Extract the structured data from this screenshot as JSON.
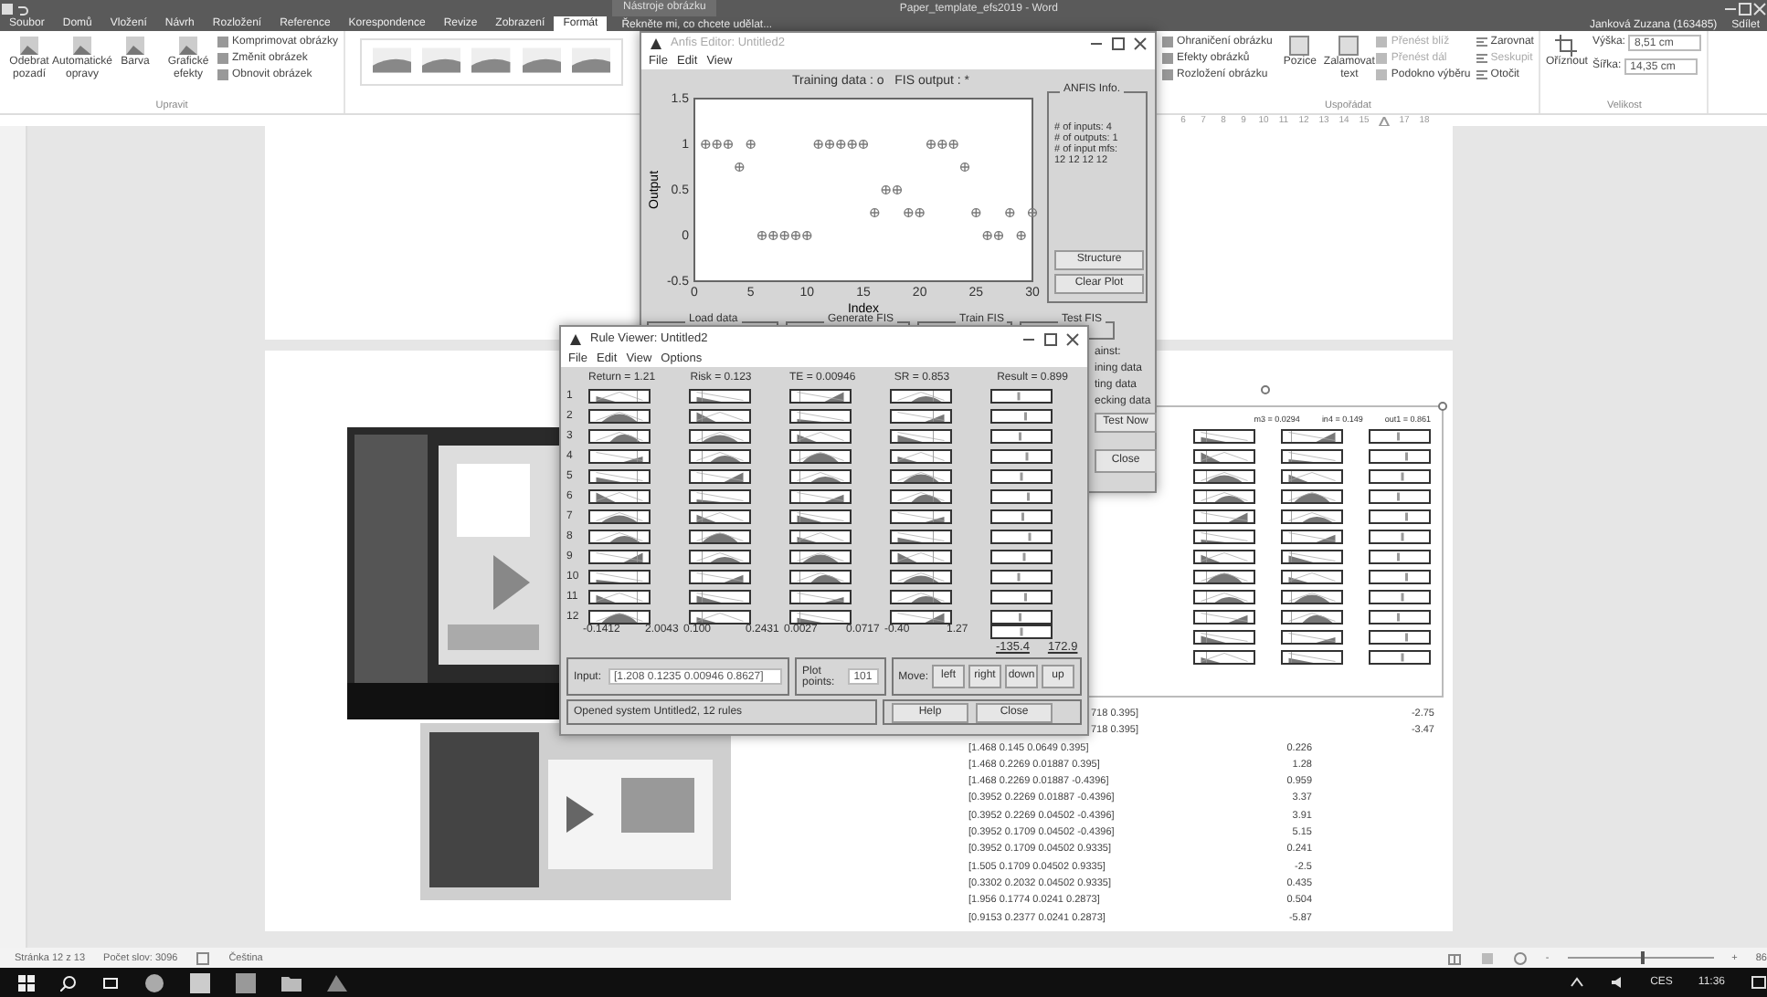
{
  "word": {
    "title_bar": {
      "context": "Nástroje obrázku",
      "title": "Paper_template_efs2019 - Word"
    },
    "tabs": [
      {
        "label": "Soubor",
        "selected": false
      },
      {
        "label": "Domů",
        "selected": false
      },
      {
        "label": "Vložení",
        "selected": false
      },
      {
        "label": "Návrh",
        "selected": false
      },
      {
        "label": "Rozložení",
        "selected": false
      },
      {
        "label": "Reference",
        "selected": false
      },
      {
        "label": "Korespondence",
        "selected": false
      },
      {
        "label": "Revize",
        "selected": false
      },
      {
        "label": "Zobrazení",
        "selected": false
      },
      {
        "label": "Formát",
        "selected": true
      }
    ],
    "tell_me": "Řekněte mi, co chcete udělat...",
    "user": "Janková Zuzana (163485)",
    "share": "Sdílet",
    "ribbon_left": {
      "big_buttons": [
        "Odebrat pozadí",
        "Automatické opravy",
        "Barva",
        "Grafické efekty"
      ],
      "small_buttons": [
        "Komprimovat obrázky",
        "Změnit obrázek",
        "Obnovit obrázek"
      ],
      "group": "Upravit"
    },
    "ribbon_right": {
      "style_buttons": [
        "Ohraničení obrázku",
        "Efekty obrázků",
        "Rozložení obrázku"
      ],
      "arrange_big": [
        "Pozice",
        "Zalamovat text"
      ],
      "arrange_small": [
        "Přenést blíž",
        "Přenést dál",
        "Podokno výběru"
      ],
      "align": [
        "Zarovnat",
        "Seskupit",
        "Otočit"
      ],
      "arrange_group": "Uspořádat",
      "crop": "Oříznout",
      "height_label": "Výška:",
      "height": "8,51 cm",
      "width_label": "Šířka:",
      "width": "14,35 cm",
      "size_group": "Velikost"
    },
    "ruler": [
      {
        "kind": "number",
        "text": "6"
      },
      {
        "kind": "number",
        "text": "7"
      },
      {
        "kind": "number",
        "text": "8"
      },
      {
        "kind": "number",
        "text": "9"
      },
      {
        "kind": "number",
        "text": "10"
      },
      {
        "kind": "number",
        "text": "11"
      },
      {
        "kind": "number",
        "text": "12"
      },
      {
        "kind": "number",
        "text": "13"
      },
      {
        "kind": "number",
        "text": "14"
      },
      {
        "kind": "number",
        "text": "15"
      },
      {
        "kind": "marker"
      },
      {
        "kind": "number",
        "text": "17"
      },
      {
        "kind": "number",
        "text": "18"
      }
    ],
    "figure_labels": [
      "m3 = 0.0294",
      "in4 = 0.149",
      "out1 = 0.861"
    ],
    "results": [
      {
        "kind": "covered",
        "vector": "718 0.395]",
        "value": "-2.75"
      },
      {
        "kind": "covered",
        "vector": "718 0.395]",
        "value": "-3.47"
      },
      {
        "kind": "full",
        "vector": "[1.468 0.145 0.0649 0.395]",
        "value": "0.226"
      },
      {
        "kind": "full",
        "vector": "[1.468 0.2269 0.01887 0.395]",
        "value": "1.28"
      },
      {
        "kind": "full",
        "vector": "[1.468 0.2269 0.01887 -0.4396]",
        "value": "0.959"
      },
      {
        "kind": "full",
        "vector": "[0.3952 0.2269 0.01887 -0.4396]",
        "value": "3.37"
      },
      {
        "kind": "full",
        "vector": "[0.3952 0.2269 0.04502 -0.4396]",
        "value": "3.91"
      },
      {
        "kind": "full",
        "vector": "[0.3952 0.1709 0.04502 -0.4396]",
        "value": "5.15"
      },
      {
        "kind": "full",
        "vector": "[0.3952 0.1709 0.04502 0.9335]",
        "value": "0.241"
      },
      {
        "kind": "full",
        "vector": "[1.505 0.1709 0.04502 0.9335]",
        "value": "-2.5"
      },
      {
        "kind": "full",
        "vector": "[0.3302 0.2032 0.04502 0.9335]",
        "value": "0.435"
      },
      {
        "kind": "full",
        "vector": "[1.956 0.1774 0.0241 0.2873]",
        "value": "0.504"
      },
      {
        "kind": "full",
        "vector": "[0.9153 0.2377 0.0241 0.2873]",
        "value": "-5.87"
      }
    ],
    "status_bar": {
      "page": "Stránka 12 z 13",
      "words": "Počet slov: 3096",
      "language": "Čeština",
      "zoom_out": "-",
      "zoom_in": "+",
      "zoom": {
        "level": 0.5
      },
      "zoom_value": "86"
    }
  },
  "anfis": {
    "title": "Anfis Editor: Untitled2",
    "menu": [
      "File",
      "Edit",
      "View"
    ],
    "chart_data": {
      "type": "scatter",
      "title": "Training data : o   FIS output : *",
      "xlabel": "Index",
      "ylabel": "Output",
      "x": [
        1,
        2,
        3,
        4,
        5,
        6,
        7,
        8,
        9,
        10,
        11,
        12,
        13,
        14,
        15,
        16,
        17,
        18,
        19,
        20,
        21,
        22,
        23,
        24,
        25,
        26,
        27,
        28,
        29,
        30
      ],
      "series": [
        {
          "color": "#7a7a7a",
          "values": [
            1,
            1,
            1,
            0.75,
            1,
            0,
            0,
            0,
            0,
            0,
            1,
            1,
            1,
            1,
            1,
            0.25,
            0.5,
            0.5,
            0.25,
            0.25,
            1,
            1,
            1,
            0.75,
            0.25,
            0,
            0,
            0.25,
            0,
            0.25
          ]
        }
      ],
      "xlim": [
        0,
        30
      ],
      "ylim": [
        -0.5,
        1.5
      ],
      "xticks": [
        0,
        5,
        10,
        15,
        20,
        25,
        30
      ],
      "yticks": [
        -0.5,
        0,
        0.5,
        1,
        1.5
      ]
    },
    "info": {
      "title": "ANFIS Info.",
      "lines": [
        "# of inputs: 4",
        "# of outputs: 1",
        "# of input mfs:",
        "12 12 12 12"
      ],
      "buttons": [
        "Structure",
        "Clear Plot"
      ]
    },
    "panels": [
      "Load data",
      "Generate FIS",
      "Train FIS",
      "Test FIS"
    ],
    "test_lines": [
      "ainst:",
      "ining data",
      "ting data",
      "ecking data"
    ],
    "test_button": "Test Now",
    "close": "Close"
  },
  "rule_viewer": {
    "title": "Rule Viewer: Untitled2",
    "menu": [
      "File",
      "Edit",
      "View",
      "Options"
    ],
    "columns": [
      {
        "header": "Return = 1.21",
        "min": "-0.1412",
        "max": "2.0043"
      },
      {
        "header": "Risk = 0.123",
        "min": "0.100",
        "max": "0.2431"
      },
      {
        "header": "TE = 0.00946",
        "min": "0.0027",
        "max": "0.0717"
      },
      {
        "header": "SR = 0.853",
        "min": "-0.40",
        "max": "1.27"
      }
    ],
    "result": {
      "header": "Result = 0.899",
      "min": "-135.4",
      "max": "172.9"
    },
    "rules": [
      "1",
      "2",
      "3",
      "4",
      "5",
      "6",
      "7",
      "8",
      "9",
      "10",
      "11",
      "12"
    ],
    "input_label": "Input:",
    "input": "[1.208 0.1235 0.00946 0.8627]",
    "points_label": "Plot points:",
    "points": "101",
    "move_label": "Move:",
    "move_buttons": [
      "left",
      "right",
      "down",
      "up"
    ],
    "status": "Opened system Untitled2, 12 rules",
    "help": "Help",
    "close": "Close"
  },
  "taskbar": {
    "language": "CES",
    "time": "11:36"
  }
}
